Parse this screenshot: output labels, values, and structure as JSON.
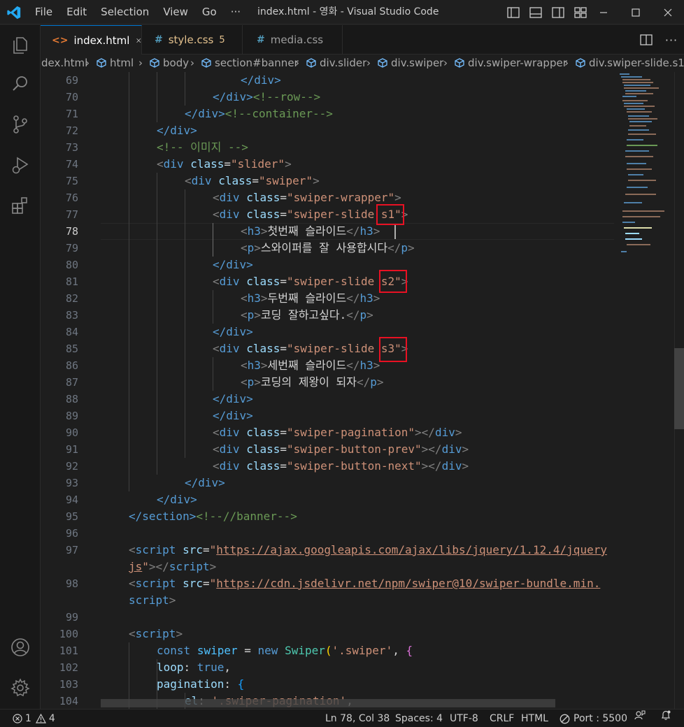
{
  "window": {
    "title": "index.html - 영화 - Visual Studio Code",
    "menu": [
      "File",
      "Edit",
      "Selection",
      "View",
      "Go",
      "···"
    ]
  },
  "tabs": [
    {
      "label": "index.html",
      "icon": "html-file-icon",
      "icon_glyph": "<>",
      "active": true
    },
    {
      "label": "style.css",
      "icon": "css-file-icon",
      "icon_glyph": "#",
      "badge": "5",
      "modified_color": "#e2c08d"
    },
    {
      "label": "media.css",
      "icon": "css-file-icon",
      "icon_glyph": "#"
    }
  ],
  "breadcrumb": [
    "dex.html",
    "html",
    "body",
    "section#banner",
    "div.slider",
    "div.swiper",
    "div.swiper-wrapper",
    "div.swiper-slide.s1"
  ],
  "editor": {
    "line_numbers": [
      "69",
      "70",
      "71",
      "72",
      "73",
      "74",
      "75",
      "76",
      "77",
      "78",
      "79",
      "80",
      "81",
      "82",
      "83",
      "84",
      "85",
      "86",
      "87",
      "88",
      "89",
      "90",
      "91",
      "92",
      "93",
      "94",
      "95",
      "96",
      "97",
      "",
      "98",
      "",
      "99",
      "100",
      "101",
      "102",
      "103",
      "104"
    ],
    "current_line": "78",
    "highlighted_classes": [
      "s1\"",
      "s2\"",
      "s3\""
    ]
  },
  "code": {
    "l69": "</div>",
    "l70a": "</div>",
    "l70b": "<!--row-->",
    "l71a": "</div>",
    "l71b": "<!--container-->",
    "l72": "</div>",
    "l73": "<!-- 이미지 -->",
    "l74": [
      "<",
      "div",
      " ",
      "class",
      "=",
      "\"slider\"",
      ">"
    ],
    "l75": [
      "<",
      "div",
      " ",
      "class",
      "=",
      "\"swiper\"",
      ">"
    ],
    "l76": [
      "<",
      "div",
      " ",
      "class",
      "=",
      "\"swiper-wrapper\"",
      ">"
    ],
    "l77": [
      "<",
      "div",
      " ",
      "class",
      "=",
      "\"swiper-slide s1\"",
      ">"
    ],
    "l78": [
      "<",
      "h3",
      ">",
      "첫번째 슬라이드",
      "</",
      "h3",
      ">"
    ],
    "l79": [
      "<",
      "p",
      ">",
      "스와이퍼를 잘 사용합시다",
      "</",
      "p",
      ">"
    ],
    "l80": "</div>",
    "l81": [
      "<",
      "div",
      " ",
      "class",
      "=",
      "\"swiper-slide s2\"",
      ">"
    ],
    "l82": [
      "<",
      "h3",
      ">",
      "두번째 슬라이드",
      "</",
      "h3",
      ">"
    ],
    "l83": [
      "<",
      "p",
      ">",
      "코딩 잘하고싶다.",
      "</",
      "p",
      ">"
    ],
    "l84": "</div>",
    "l85": [
      "<",
      "div",
      " ",
      "class",
      "=",
      "\"swiper-slide s3\"",
      ">"
    ],
    "l86": [
      "<",
      "h3",
      ">",
      "세번째 슬라이드",
      "</",
      "h3",
      ">"
    ],
    "l87": [
      "<",
      "p",
      ">",
      "코딩의 제왕이 되자",
      "</",
      "p",
      ">"
    ],
    "l88": "</div>",
    "l89": "</div>",
    "l90": [
      "<",
      "div",
      " ",
      "class",
      "=",
      "\"swiper-pagination\"",
      "></",
      "div",
      ">"
    ],
    "l91": [
      "<",
      "div",
      " ",
      "class",
      "=",
      "\"swiper-button-prev\"",
      "></",
      "div",
      ">"
    ],
    "l92": [
      "<",
      "div",
      " ",
      "class",
      "=",
      "\"swiper-button-next\"",
      "></",
      "div",
      ">"
    ],
    "l93": "</div>",
    "l94": "</div>",
    "l95a": "</section>",
    "l95b": "<!--//banner-->",
    "l97a": [
      "<",
      "script",
      " ",
      "src",
      "=",
      "\"",
      "https://ajax.googleapis.com/ajax/libs/jquery/1.12.4/jquery"
    ],
    "l97b": [
      "js",
      "\"",
      "></",
      "script",
      ">"
    ],
    "l98a": [
      "<",
      "script",
      " ",
      "src",
      "=",
      "\"",
      "https://cdn.jsdelivr.net/npm/swiper@10/swiper-bundle.min."
    ],
    "l98b": [
      "script",
      ">"
    ],
    "l100": [
      "<",
      "script",
      ">"
    ],
    "l101": [
      "const",
      " ",
      "swiper",
      " = ",
      "new",
      " ",
      "Swiper",
      "(",
      "'.swiper'",
      ", ",
      "{"
    ],
    "l102": [
      "loop",
      ": ",
      "true",
      ","
    ],
    "l103": [
      "pagination",
      ": ",
      "{"
    ],
    "l104": [
      "el",
      ": ",
      "'.swiper-pagination'",
      ","
    ]
  },
  "status": {
    "errors": "1",
    "warnings": "4",
    "position": "Ln 78, Col 38",
    "spaces": "Spaces: 4",
    "encoding": "UTF-8",
    "eol": "CRLF",
    "language": "HTML",
    "port": "Port : 5500"
  },
  "colors": {
    "accent": "#0078d4",
    "highlight_box": "#e81123",
    "tag": "#569cd6",
    "attribute": "#9cdcfe",
    "string": "#ce9178",
    "comment": "#6a9955"
  }
}
